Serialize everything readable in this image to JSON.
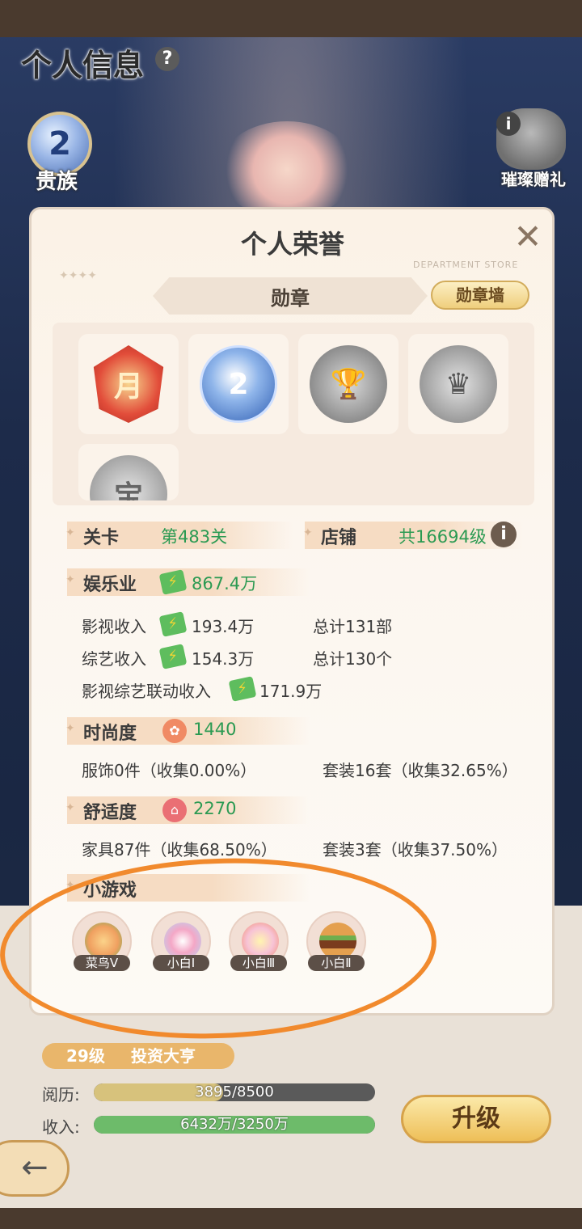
{
  "page": {
    "title": "个人信息",
    "help_icon": "?",
    "noble": {
      "level": "2",
      "label": "贵族"
    },
    "gift": {
      "info": "i",
      "label": "璀璨赠礼"
    }
  },
  "under": {
    "level_text": "29级",
    "rank_text": "投资大亨",
    "rows": [
      {
        "label": "阅历:",
        "value": "3895/8500",
        "progress": 0.46
      },
      {
        "label": "收入:",
        "value": "6432万/3250万",
        "progress": 1.0
      }
    ],
    "upgrade_label": "升级",
    "back_icon": "←"
  },
  "modal": {
    "title": "个人荣誉",
    "close_icon": "✕",
    "dept_text": "DEPARTMENT STORE",
    "stars": "✦✦✦✦",
    "tab_label": "勋章",
    "wall_button": "勋章墙",
    "medals": [
      {
        "name": "month-medal-icon",
        "glyph": "月"
      },
      {
        "name": "noble-2-medal-icon",
        "glyph": "2"
      },
      {
        "name": "oscar-trophy-medal-icon",
        "glyph": "🏆"
      },
      {
        "name": "crown-medal-icon",
        "glyph": "♛"
      },
      {
        "name": "partial-medal-icon",
        "glyph": "宝"
      }
    ],
    "stage": {
      "label": "关卡",
      "value": "第483关"
    },
    "shop": {
      "label": "店铺",
      "value": "共16694级",
      "info_icon": "i"
    },
    "entertainment": {
      "label": "娱乐业",
      "value": "867.4万",
      "film_label": "影视收入",
      "film_value": "193.4万",
      "film_total": "总计131部",
      "variety_label": "综艺收入",
      "variety_value": "154.3万",
      "variety_total": "总计130个",
      "combo_label": "影视综艺联动收入",
      "combo_value": "171.9万"
    },
    "fashion": {
      "label": "时尚度",
      "value": "1440",
      "items": "服饰0件（收集0.00%）",
      "sets": "套装16套（收集32.65%）"
    },
    "comfort": {
      "label": "舒适度",
      "value": "2270",
      "items": "家具87件（收集68.50%）",
      "sets": "套装3套（收集37.50%）"
    },
    "minigames": {
      "label": "小游戏",
      "items": [
        {
          "label": "菜鸟Ⅴ",
          "icon": "skewer-food-icon",
          "color": "#f0a060"
        },
        {
          "label": "小白Ⅰ",
          "icon": "candy-jar-icon",
          "color": "#f4a7c6"
        },
        {
          "label": "小白Ⅲ",
          "icon": "drink-glass-icon",
          "color": "#f7c3d6"
        },
        {
          "label": "小白Ⅱ",
          "icon": "burger-icon",
          "color": "#c9843f"
        }
      ]
    }
  }
}
